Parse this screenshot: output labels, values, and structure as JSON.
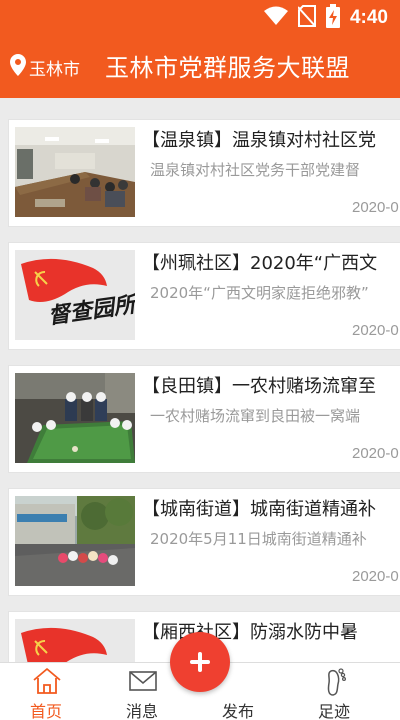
{
  "status_bar": {
    "time": "4:40"
  },
  "app_bar": {
    "location": "玉林市",
    "title": "玉林市党群服务大联盟"
  },
  "news": [
    {
      "tag": "【温泉镇】",
      "title": "温泉镇对村社区党",
      "summary": "温泉镇对村社区党务干部党建督",
      "date": "2020-0"
    },
    {
      "tag": "【州珮社区】",
      "title": "2020年“广西文",
      "summary": "2020年“广西文明家庭拒绝邪教”",
      "date": "2020-0"
    },
    {
      "tag": "【良田镇】",
      "title": "一农村赌场流窜至",
      "summary": "一农村赌场流窜到良田被一窝端",
      "date": "2020-0"
    },
    {
      "tag": "【城南街道】",
      "title": "城南街道精通补",
      "summary": "2020年5月11日城南街道精通补",
      "date": "2020-0"
    },
    {
      "tag": "【厢西社区】",
      "title": "防溺水防中暑",
      "summary": "",
      "date": ""
    }
  ],
  "thumb_texts": {
    "banner_text": "督查园所"
  },
  "tabbar": {
    "home": "首页",
    "messages": "消息",
    "publish": "发布",
    "footprint": "足迹"
  },
  "colors": {
    "brand": "#f25a1f",
    "fab": "#ef4030",
    "flag": "#e8332a"
  }
}
